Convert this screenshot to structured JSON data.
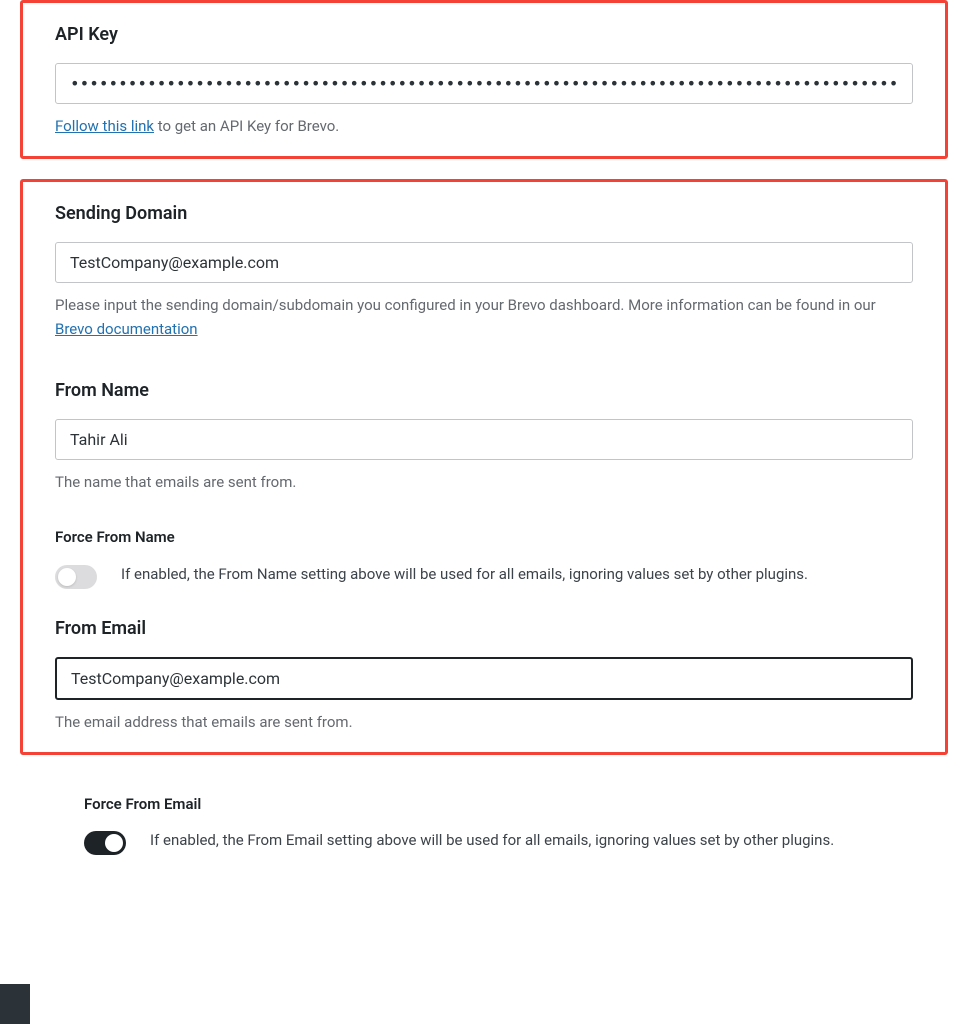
{
  "api_key": {
    "label": "API Key",
    "value": "••••••••••••••••••••••••••••••••••••••••••••••••••••••••••••••••••••••••••••••••••••••••",
    "help_prefix_link": "Follow this link",
    "help_suffix": " to get an API Key for Brevo."
  },
  "sending_domain": {
    "label": "Sending Domain",
    "value": "TestCompany@example.com",
    "help_prefix": "Please input the sending domain/subdomain you configured in your Brevo dashboard. More information can be found in our ",
    "help_link": "Brevo documentation"
  },
  "from_name": {
    "label": "From Name",
    "value": "Tahir Ali",
    "help": "The name that emails are sent from."
  },
  "force_from_name": {
    "label": "Force From Name",
    "enabled": false,
    "desc": "If enabled, the From Name setting above will be used for all emails, ignoring values set by other plugins."
  },
  "from_email": {
    "label": "From Email",
    "value": "TestCompany@example.com",
    "help": "The email address that emails are sent from."
  },
  "force_from_email": {
    "label": "Force From Email",
    "enabled": true,
    "desc": "If enabled, the From Email setting above will be used for all emails, ignoring values set by other plugins."
  }
}
